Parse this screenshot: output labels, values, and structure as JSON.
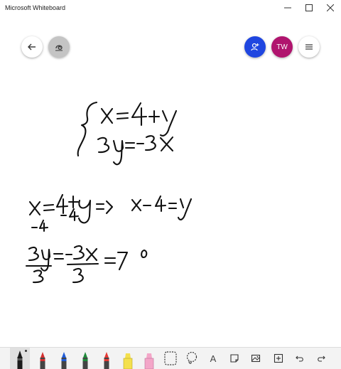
{
  "window": {
    "title": "Microsoft Whiteboard"
  },
  "topbar": {
    "avatar_initials": "TW"
  },
  "colors": {
    "share": "#1f46e0",
    "avatar": "#b0146e",
    "ink": "#111111",
    "pen_black": "#1a1a1a",
    "pen_red": "#d32f2f",
    "pen_blue": "#1e5bd8",
    "pen_green": "#1f8a3a",
    "pen_red2": "#e53935",
    "highlighter_yellow": "#f4e04d",
    "highlighter_pink": "#f3a6c8"
  },
  "toolbar": {
    "text_tool_glyph": "A",
    "selected_tool": "pen-black"
  }
}
